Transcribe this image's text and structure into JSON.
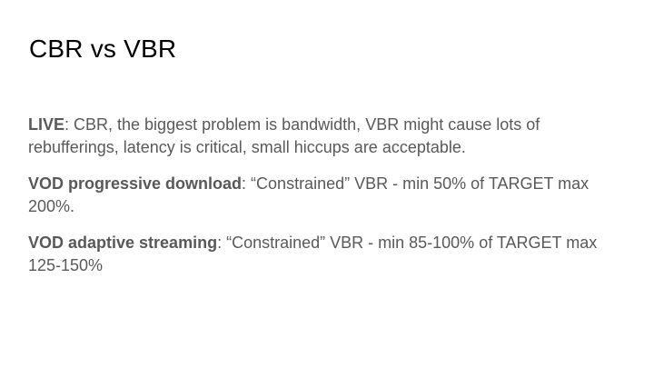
{
  "slide": {
    "title": "CBR vs VBR",
    "paragraphs": [
      {
        "label": "LIVE",
        "text": ": CBR, the biggest problem is bandwidth, VBR might cause lots of rebufferings, latency is critical, small hiccups are acceptable."
      },
      {
        "label": "VOD progressive download",
        "text": ": “Constrained” VBR - min 50% of TARGET max 200%."
      },
      {
        "label": "VOD adaptive streaming",
        "text": ": “Constrained” VBR - min 85-100% of TARGET max 125-150%"
      }
    ]
  }
}
